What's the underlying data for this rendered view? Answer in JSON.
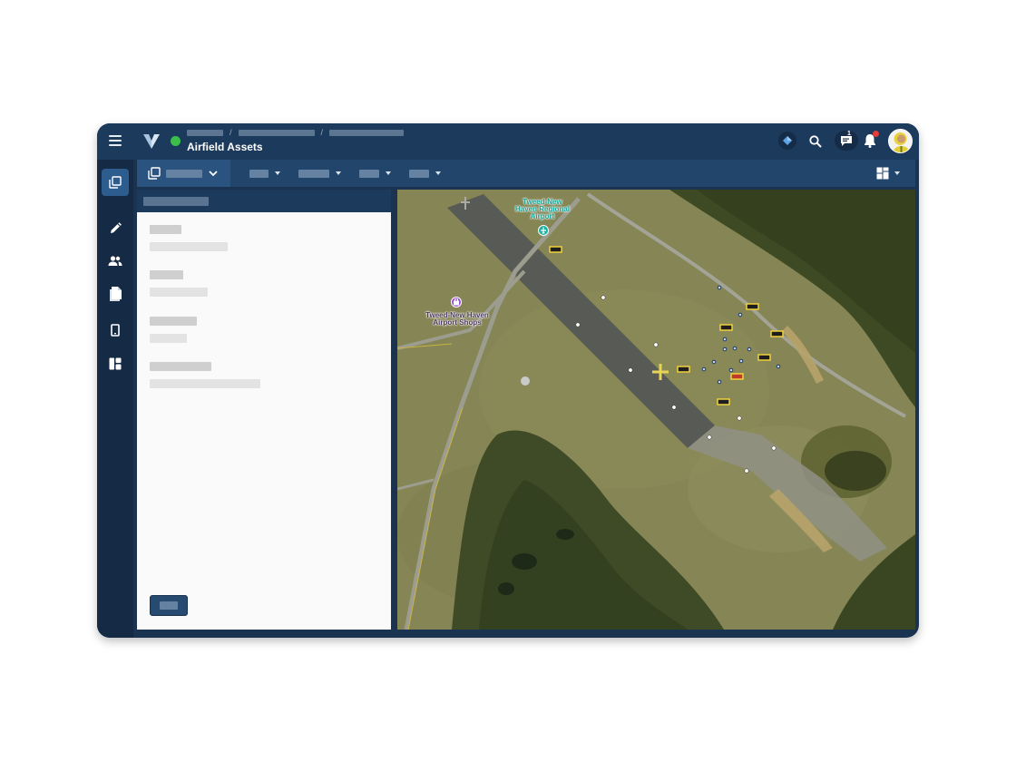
{
  "header": {
    "title": "Airfield Assets",
    "breadcrumb_separator": "/",
    "status_color": "#3cbf4a",
    "chat_unread_count": "1",
    "icons": [
      "menu-icon",
      "logo-icon",
      "diamond-icon",
      "search-icon",
      "chat-icon",
      "bell-icon",
      "avatar"
    ]
  },
  "rail": {
    "items": [
      "copy-icon",
      "pencil-icon",
      "users-icon",
      "document-icon",
      "tablet-icon",
      "dashboard-icon"
    ],
    "active_index": 0
  },
  "toolbar": {
    "icons": [
      "copy-icon",
      "chevron-down-icon",
      "caret-down-icon",
      "layout-grid-icon"
    ]
  },
  "map": {
    "labels": {
      "airport": "Tweed-New Haven Regional Airport",
      "shops": "Tweed-New Haven Airport Shops"
    },
    "poi_icons": [
      "airplane-icon",
      "shopping-bag-icon"
    ],
    "colors": {
      "asset_marker_outline": "#f0d23c",
      "asset_marker_alert": "#c0392b",
      "runway": "#585b55",
      "grass": "#858555",
      "marsh": "#3a4a22"
    }
  }
}
